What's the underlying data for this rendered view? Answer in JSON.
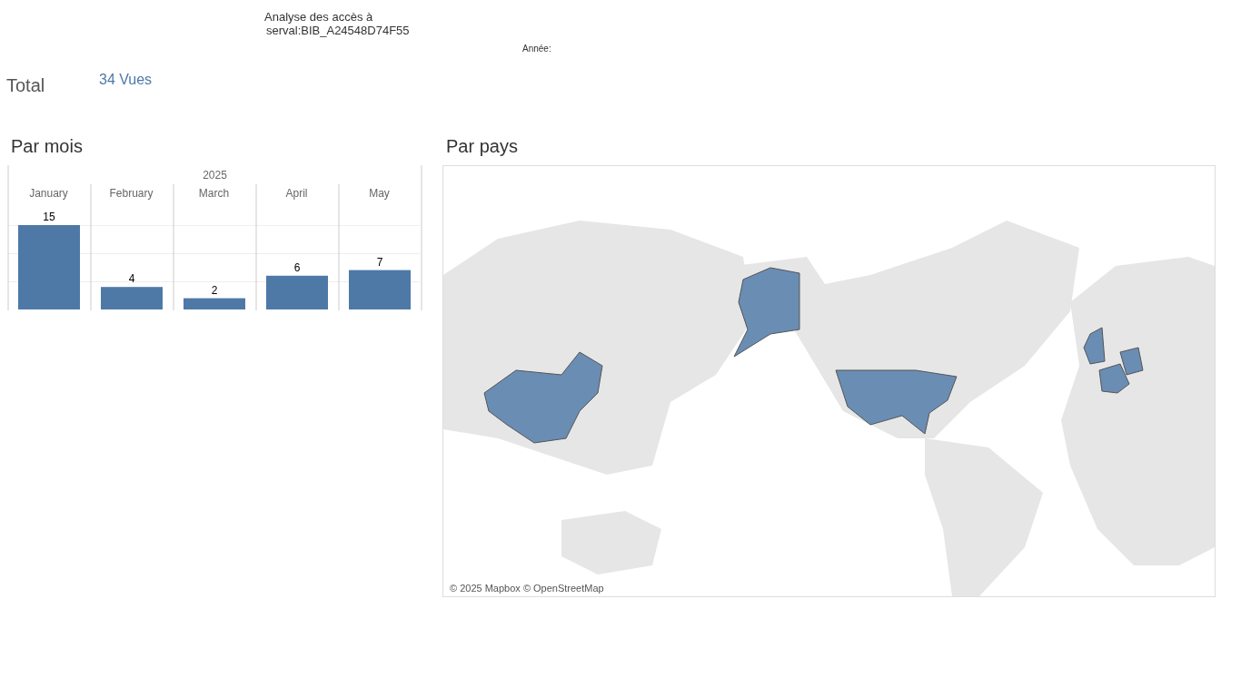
{
  "header": {
    "title_line_1": "Analyse des accès à",
    "title_line_2": "serval:BIB_A24548D74F55",
    "year_filter_label": "Année:"
  },
  "total": {
    "label": "Total",
    "value": "34 Vues"
  },
  "par_mois": {
    "title": "Par mois",
    "chart_data": {
      "type": "bar",
      "title": "2025",
      "categories": [
        "January",
        "February",
        "March",
        "April",
        "May"
      ],
      "values": [
        15,
        4,
        2,
        6,
        7
      ],
      "data_labels": true
    }
  },
  "par_pays": {
    "title": "Par pays",
    "attribution": "© 2025 Mapbox © OpenStreetMap"
  }
}
